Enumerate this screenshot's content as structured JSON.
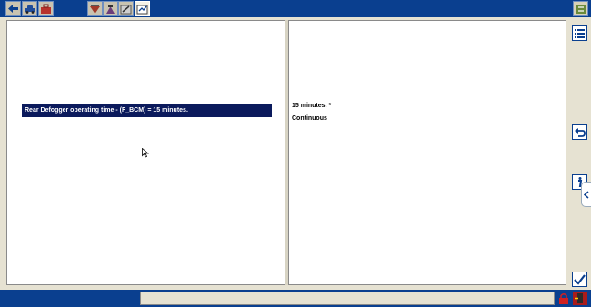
{
  "toolbar": {
    "buttons": [
      {
        "icon": "back-arrow-icon"
      },
      {
        "icon": "vehicle-icon"
      },
      {
        "icon": "toolbox-icon"
      },
      {
        "icon": "diagnostic-tool-icon"
      },
      {
        "icon": "service-tool-icon"
      },
      {
        "icon": "module-programming-icon"
      },
      {
        "icon": "configuration-icon"
      }
    ],
    "right_button": {
      "icon": "window-switch-icon"
    }
  },
  "left_panel": {
    "selected_item": "Rear Defogger operating time - (F_BCM) = 15 minutes."
  },
  "right_panel": {
    "lines": [
      "15 minutes. *",
      "Continuous"
    ]
  },
  "sidebar": {
    "buttons": [
      {
        "icon": "list-icon"
      },
      {
        "icon": "undo-icon"
      },
      {
        "icon": "info-icon"
      },
      {
        "icon": "checkmark-icon"
      }
    ]
  },
  "statusbar": {
    "text": ""
  },
  "colors": {
    "chrome_blue": "#0a3f8f",
    "selection_navy": "#0b1a5c",
    "panel_bg": "#ffffff",
    "frame_beige": "#e6e2d2"
  }
}
